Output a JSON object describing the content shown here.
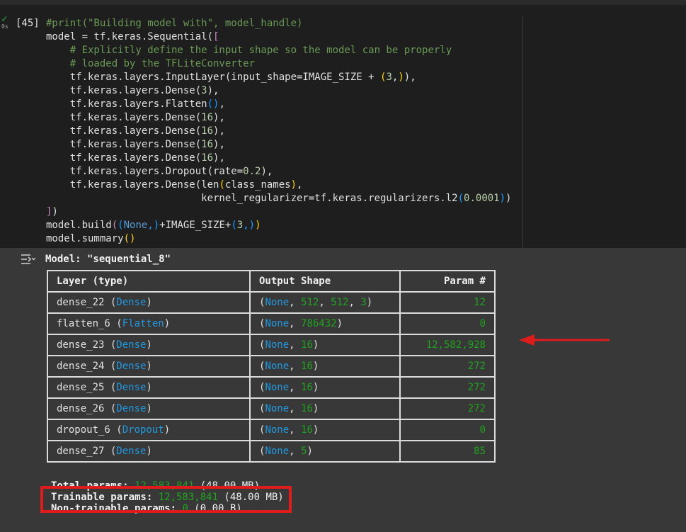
{
  "cell": {
    "status_icon": "check-icon",
    "exec_time": "0s",
    "execution_count": "[45]",
    "code_lines": [
      [
        {
          "t": "#print(\"Building model with\", model_handle)",
          "c": "c-com"
        }
      ],
      [
        {
          "t": "model = tf.keras.Sequential("
        },
        {
          "t": "[",
          "c": "c-p1"
        }
      ],
      [
        {
          "t": "    # Explicitly define the input shape so the model can be properly",
          "c": "c-com"
        }
      ],
      [
        {
          "t": "    # loaded by the TFLiteConverter",
          "c": "c-com"
        }
      ],
      [
        {
          "t": "    tf.keras.layers.InputLayer(input_shape=IMAGE_SIZE + "
        },
        {
          "t": "(",
          "c": "c-p2"
        },
        {
          "t": "3",
          "c": "c-num"
        },
        {
          "t": ","
        },
        {
          "t": ")",
          "c": "c-p2"
        },
        {
          "t": "),"
        }
      ],
      [
        {
          "t": "    tf.keras.layers.Dense("
        },
        {
          "t": "3",
          "c": "c-num"
        },
        {
          "t": "),"
        }
      ],
      [
        {
          "t": "    tf.keras.layers.Flatten"
        },
        {
          "t": "()",
          "c": "c-p3"
        },
        {
          "t": ","
        }
      ],
      [
        {
          "t": "    tf.keras.layers.Dense("
        },
        {
          "t": "16",
          "c": "c-num"
        },
        {
          "t": "),"
        }
      ],
      [
        {
          "t": "    tf.keras.layers.Dense("
        },
        {
          "t": "16",
          "c": "c-num"
        },
        {
          "t": "),"
        }
      ],
      [
        {
          "t": "    tf.keras.layers.Dense("
        },
        {
          "t": "16",
          "c": "c-num"
        },
        {
          "t": "),"
        }
      ],
      [
        {
          "t": "    tf.keras.layers.Dense("
        },
        {
          "t": "16",
          "c": "c-num"
        },
        {
          "t": "),"
        }
      ],
      [
        {
          "t": "    tf.keras.layers.Dropout(rate="
        },
        {
          "t": "0.2",
          "c": "c-num"
        },
        {
          "t": "),"
        }
      ],
      [
        {
          "t": "    tf.keras.layers.Dense(len"
        },
        {
          "t": "(",
          "c": "c-p2"
        },
        {
          "t": "class_names"
        },
        {
          "t": ")",
          "c": "c-p2"
        },
        {
          "t": ","
        }
      ],
      [
        {
          "t": "                          kernel_regularizer=tf.keras.regularizers.l2"
        },
        {
          "t": "(",
          "c": "c-p3"
        },
        {
          "t": "0.0001",
          "c": "c-num"
        },
        {
          "t": ")",
          "c": "c-p3"
        },
        {
          "t": ")"
        }
      ],
      [
        {
          "t": "]",
          "c": "c-p1"
        },
        {
          "t": ")"
        }
      ],
      [
        {
          "t": "model.build"
        },
        {
          "t": "(",
          "c": "c-p1"
        },
        {
          "t": "(",
          "c": "c-p3"
        },
        {
          "t": "None",
          "c": "c-kw"
        },
        {
          "t": ",",
          "c": "c-p3"
        },
        {
          "t": ")",
          "c": "c-p3"
        },
        {
          "t": "+IMAGE_SIZE+"
        },
        {
          "t": "(",
          "c": "c-p3"
        },
        {
          "t": "3",
          "c": "c-num"
        },
        {
          "t": ",",
          "c": "c-p3"
        },
        {
          "t": ")",
          "c": "c-p3"
        },
        {
          "t": ")",
          "c": "c-p2"
        }
      ],
      [
        {
          "t": "model.summary"
        },
        {
          "t": "()",
          "c": "c-p2"
        }
      ]
    ]
  },
  "output": {
    "icon": "output-collapse-icon",
    "model_label": "Model: \"sequential_8\"",
    "table": {
      "headers": [
        "Layer (type)",
        "Output Shape",
        "Param #"
      ],
      "rows": [
        {
          "name": "dense_22",
          "type": "Dense",
          "shape": [
            "512",
            "512",
            "3"
          ],
          "params": "12"
        },
        {
          "name": "flatten_6",
          "type": "Flatten",
          "shape": [
            "786432"
          ],
          "params": "0"
        },
        {
          "name": "dense_23",
          "type": "Dense",
          "shape": [
            "16"
          ],
          "params": "12,582,928"
        },
        {
          "name": "dense_24",
          "type": "Dense",
          "shape": [
            "16"
          ],
          "params": "272"
        },
        {
          "name": "dense_25",
          "type": "Dense",
          "shape": [
            "16"
          ],
          "params": "272"
        },
        {
          "name": "dense_26",
          "type": "Dense",
          "shape": [
            "16"
          ],
          "params": "272"
        },
        {
          "name": "dropout_6",
          "type": "Dropout",
          "shape": [
            "16"
          ],
          "params": "0"
        },
        {
          "name": "dense_27",
          "type": "Dense",
          "shape": [
            "5"
          ],
          "params": "85"
        }
      ]
    },
    "totals": {
      "total_label": "Total params: ",
      "total_value": "12,583,841",
      "total_unit": " (48.00 MB)",
      "trainable_label": "Trainable params: ",
      "trainable_value": "12,583,841",
      "trainable_unit": " (48.00 MB)",
      "non_trainable_label": "Non-trainable params: ",
      "non_trainable_value": "0",
      "non_trainable_unit": " (0.00 B)"
    }
  },
  "annotations": {
    "highlight_color": "#e01b1b",
    "arrow_color": "#e01b1b"
  }
}
